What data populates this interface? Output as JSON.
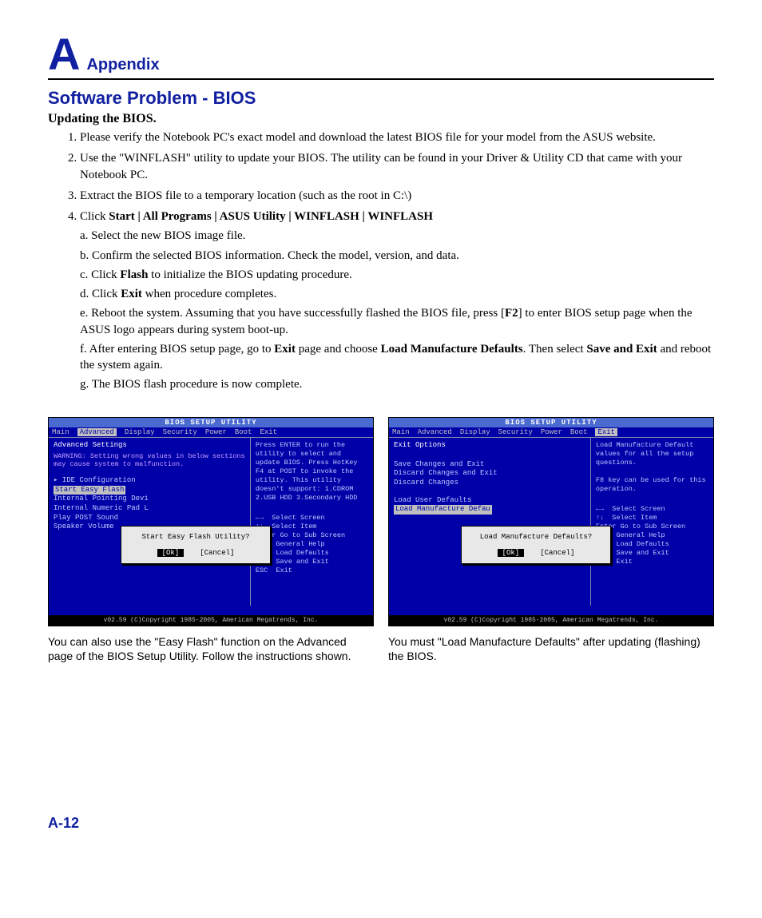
{
  "header": {
    "letter": "A",
    "label": "Appendix"
  },
  "section": {
    "title": "Software Problem - BIOS",
    "subtitle": "Updating the BIOS."
  },
  "steps": {
    "s1": "Please verify the Notebook PC's exact model and download the latest BIOS file for your model from the ASUS website.",
    "s2": "Use the \"WINFLASH\" utility to update your BIOS. The utility can be found in your Driver & Utility CD that came with your Notebook PC.",
    "s3": "Extract the BIOS file to a temporary location (such as the root in C:\\)",
    "s4_prefix": "Click ",
    "s4_bold": "Start | All Programs | ASUS Utility | WINFLASH | WINFLASH",
    "sub": {
      "a": "a. Select the new BIOS image file.",
      "b": "b. Confirm the selected BIOS information. Check the model, version, and data.",
      "c_pre": "c. Click ",
      "c_bold": "Flash",
      "c_post": " to initialize the BIOS updating procedure.",
      "d_pre": "d. Click ",
      "d_bold": "Exit",
      "d_post": " when procedure completes.",
      "e_pre": "e. Reboot the system. Assuming that you have successfully flashed the BIOS file, press [",
      "e_bold": "F2",
      "e_post": "] to enter BIOS setup page when the ASUS logo appears during system boot-up.",
      "f_pre": "f. After entering BIOS setup page, go to ",
      "f_b1": "Exit",
      "f_mid": " page and choose ",
      "f_b2": "Load Manufacture Defaults",
      "f_mid2": ". Then select ",
      "f_b3": "Save and Exit",
      "f_post": " and reboot the system again.",
      "g": "g. The BIOS flash procedure is now complete."
    }
  },
  "bios": {
    "title": "BIOS SETUP UTILITY",
    "menu": [
      "Main",
      "Advanced",
      "Display",
      "Security",
      "Power",
      "Boot",
      "Exit"
    ],
    "footer": "v02.59 (C)Copyright 1985-2005, American Megatrends, Inc.",
    "left1": {
      "heading": "Advanced Settings",
      "warn": "WARNING: Setting wrong values in below sections may cause system to malfunction.",
      "items": [
        "▸ IDE Configuration",
        "Start Easy Flash",
        "Internal Pointing Devi",
        "Internal Numeric Pad L",
        "Play POST Sound",
        "Speaker Volume"
      ],
      "popup": "Start Easy Flash Utility?",
      "ok": "[Ok]",
      "cancel": "[Cancel]"
    },
    "right1": "Press ENTER to run the utility to select and update BIOS. Press HotKey F4 at POST to invoke the utility. This utility doesn't support: 1.CDROM 2.USB HDD 3.Secondary HDD",
    "nav": "←→  Select Screen\n↑↓  Select Item\nEnter Go to Sub Screen\nF1   General Help\nF9   Load Defaults\nF10  Save and Exit\nESC  Exit",
    "left2": {
      "heading": "Exit Options",
      "items": [
        "Save Changes and Exit",
        "Discard Changes and Exit",
        "Discard Changes",
        "",
        "Load User Defaults",
        "Load Manufacture Defau"
      ],
      "popup": "Load Manufacture Defaults?",
      "ok": "[Ok]",
      "cancel": "[Cancel]"
    },
    "right2": "Load Manufacture Default values for all the setup questions.\n\nF8 key can be used for this operation."
  },
  "captions": {
    "c1": "You can also use the \"Easy Flash\" function on the Advanced page of the BIOS Setup Utility. Follow the instructions shown.",
    "c2": "You must \"Load Manufacture Defaults\" after updating (flashing) the BIOS."
  },
  "page": "A-12"
}
